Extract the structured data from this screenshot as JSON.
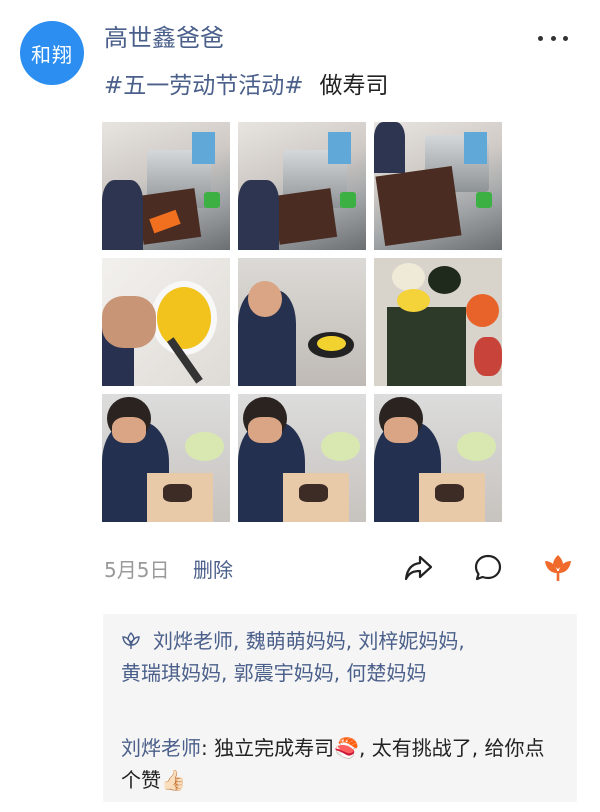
{
  "post": {
    "avatar_text": "和翔",
    "author": "高世鑫爸爸",
    "hashtag": "#五一劳动节活动#",
    "text": "做寿司",
    "date": "5月5日",
    "delete_label": "删除"
  },
  "photos": [
    {
      "name": "photo-1"
    },
    {
      "name": "photo-2"
    },
    {
      "name": "photo-3"
    },
    {
      "name": "photo-4"
    },
    {
      "name": "photo-5"
    },
    {
      "name": "photo-6"
    },
    {
      "name": "photo-7"
    },
    {
      "name": "photo-8"
    },
    {
      "name": "photo-9"
    }
  ],
  "likes": {
    "names": [
      "刘烨老师",
      "魏萌萌妈妈",
      "刘梓妮妈妈",
      "黄瑞琪妈妈",
      "郭震宇妈妈",
      "何楚妈妈"
    ],
    "line1": "刘烨老师, 魏萌萌妈妈, 刘梓妮妈妈,",
    "line2": "黄瑞琪妈妈, 郭震宇妈妈, 何楚妈妈"
  },
  "comment": {
    "author": "刘烨老师",
    "separator": ": ",
    "text_part1": "独立完成寿司",
    "emoji1": "🍣",
    "text_part2": ", 太有挑战了, 给你点个赞",
    "emoji2": "👍🏻"
  },
  "colors": {
    "link_blue": "#4a5f8a",
    "avatar_blue": "#2b8ef0",
    "like_orange": "#f06a2c",
    "comment_bg": "#f5f5f5"
  },
  "icons": [
    "more-icon",
    "share-icon",
    "comment-icon",
    "like-flower-icon",
    "like-outline-icon"
  ]
}
